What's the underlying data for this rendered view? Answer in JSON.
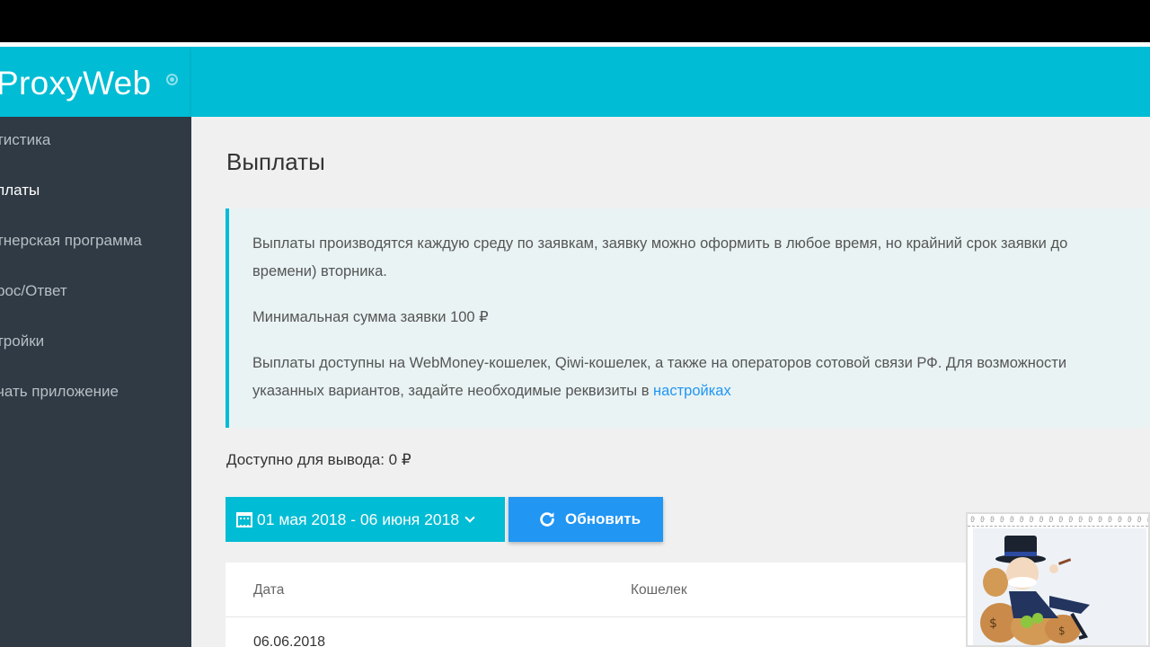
{
  "app": {
    "logo": "ProxyWeb"
  },
  "sidebar": {
    "items": [
      {
        "label": "тистика",
        "active": false
      },
      {
        "label": "платы",
        "active": true
      },
      {
        "label": "тнерская программа",
        "active": false
      },
      {
        "label": "рос/Ответ",
        "active": false
      },
      {
        "label": "тройки",
        "active": false
      },
      {
        "label": "чать приложение",
        "active": false
      }
    ]
  },
  "main": {
    "title": "Выплаты",
    "info": {
      "p1_line1": "Выплаты производятся каждую среду по заявкам, заявку можно оформить в любое время, но крайний срок заявки до",
      "p1_line2": "времени) вторника.",
      "p2": "Минимальная сумма заявки 100 ₽",
      "p3_line1": "Выплаты доступны на WebMoney-кошелек, Qiwi-кошелек, а также на операторов сотовой связи РФ. Для возможности",
      "p3_line2": "указанных вариантов, задайте необходимые реквизиты в ",
      "p3_link": "настройках"
    },
    "available": "Доступно для вывода: 0 ₽",
    "date_range": "01 мая 2018 - 06 июня 2018",
    "refresh_label": "Обновить",
    "table": {
      "headers": [
        "Дата",
        "Кошелек"
      ],
      "rows": [
        [
          "06.06.2018"
        ]
      ]
    }
  },
  "colors": {
    "accent": "#00bcd4",
    "button_blue": "#2196f3",
    "sidebar_bg": "#2f3a44"
  },
  "icons": [
    "calendar-icon",
    "chevron-down-icon",
    "refresh-icon"
  ]
}
